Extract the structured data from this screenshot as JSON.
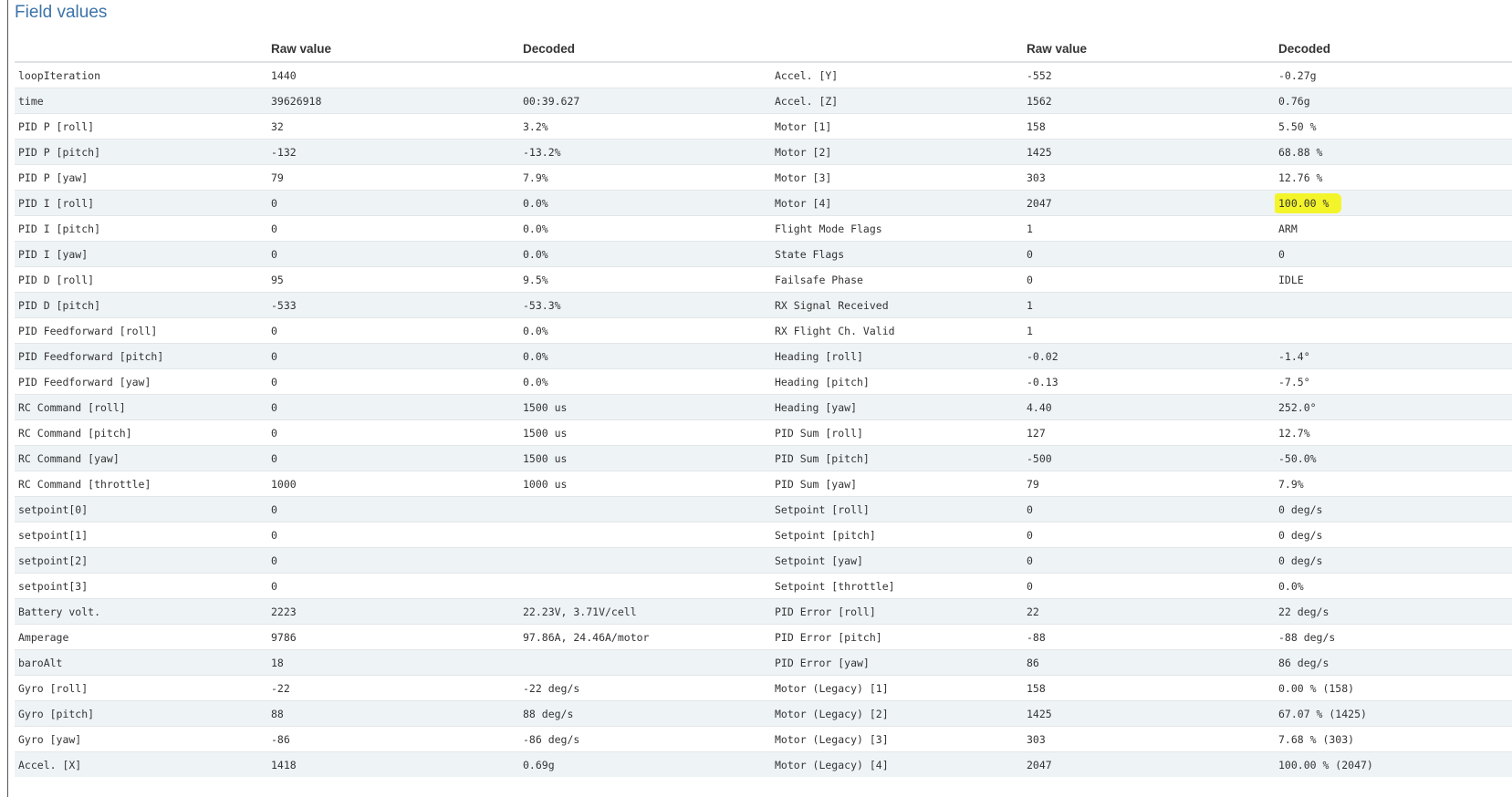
{
  "section_title": "Field values",
  "headers": [
    "",
    "Raw value",
    "Decoded",
    "",
    "Raw value",
    "Decoded"
  ],
  "rows": [
    [
      "loopIteration",
      "1440",
      "",
      "Accel. [Y]",
      "-552",
      "-0.27g"
    ],
    [
      "time",
      "39626918",
      "00:39.627",
      "Accel. [Z]",
      "1562",
      "0.76g"
    ],
    [
      "PID P [roll]",
      "32",
      "3.2%",
      "Motor [1]",
      "158",
      "5.50 %"
    ],
    [
      "PID P [pitch]",
      "-132",
      "-13.2%",
      "Motor [2]",
      "1425",
      "68.88 %"
    ],
    [
      "PID P [yaw]",
      "79",
      "7.9%",
      "Motor [3]",
      "303",
      "12.76 %"
    ],
    [
      "PID I [roll]",
      "0",
      "0.0%",
      "Motor [4]",
      "2047",
      "100.00 %"
    ],
    [
      "PID I [pitch]",
      "0",
      "0.0%",
      "Flight Mode Flags",
      "1",
      "ARM"
    ],
    [
      "PID I [yaw]",
      "0",
      "0.0%",
      "State Flags",
      "0",
      "0"
    ],
    [
      "PID D [roll]",
      "95",
      "9.5%",
      "Failsafe Phase",
      "0",
      "IDLE"
    ],
    [
      "PID D [pitch]",
      "-533",
      "-53.3%",
      "RX Signal Received",
      "1",
      ""
    ],
    [
      "PID Feedforward [roll]",
      "0",
      "0.0%",
      "RX Flight Ch. Valid",
      "1",
      ""
    ],
    [
      "PID Feedforward [pitch]",
      "0",
      "0.0%",
      "Heading [roll]",
      "-0.02",
      "-1.4°"
    ],
    [
      "PID Feedforward [yaw]",
      "0",
      "0.0%",
      "Heading [pitch]",
      "-0.13",
      "-7.5°"
    ],
    [
      "RC Command [roll]",
      "0",
      "1500 us",
      "Heading [yaw]",
      "4.40",
      "252.0°"
    ],
    [
      "RC Command [pitch]",
      "0",
      "1500 us",
      "PID Sum [roll]",
      "127",
      "12.7%"
    ],
    [
      "RC Command [yaw]",
      "0",
      "1500 us",
      "PID Sum [pitch]",
      "-500",
      "-50.0%"
    ],
    [
      "RC Command [throttle]",
      "1000",
      "1000 us",
      "PID Sum [yaw]",
      "79",
      "7.9%"
    ],
    [
      "setpoint[0]",
      "0",
      "",
      "Setpoint [roll]",
      "0",
      "0 deg/s"
    ],
    [
      "setpoint[1]",
      "0",
      "",
      "Setpoint [pitch]",
      "0",
      "0 deg/s"
    ],
    [
      "setpoint[2]",
      "0",
      "",
      "Setpoint [yaw]",
      "0",
      "0 deg/s"
    ],
    [
      "setpoint[3]",
      "0",
      "",
      "Setpoint [throttle]",
      "0",
      "0.0%"
    ],
    [
      "Battery volt.",
      "2223",
      "22.23V, 3.71V/cell",
      "PID Error [roll]",
      "22",
      "22 deg/s"
    ],
    [
      "Amperage",
      "9786",
      "97.86A, 24.46A/motor",
      "PID Error [pitch]",
      "-88",
      "-88 deg/s"
    ],
    [
      "baroAlt",
      "18",
      "",
      "PID Error [yaw]",
      "86",
      "86 deg/s"
    ],
    [
      "Gyro [roll]",
      "-22",
      "-22 deg/s",
      "Motor (Legacy) [1]",
      "158",
      "0.00 % (158)"
    ],
    [
      "Gyro [pitch]",
      "88",
      "88 deg/s",
      "Motor (Legacy) [2]",
      "1425",
      "67.07 % (1425)"
    ],
    [
      "Gyro [yaw]",
      "-86",
      "-86 deg/s",
      "Motor (Legacy) [3]",
      "303",
      "7.68 % (303)"
    ],
    [
      "Accel. [X]",
      "1418",
      "0.69g",
      "Motor (Legacy) [4]",
      "2047",
      "100.00 % (2047)"
    ]
  ],
  "highlight": {
    "row": 5,
    "col": 5,
    "color": "#f3f52a"
  },
  "colors": {
    "title": "#3d73a8",
    "row_alt": "#eef3f6"
  }
}
